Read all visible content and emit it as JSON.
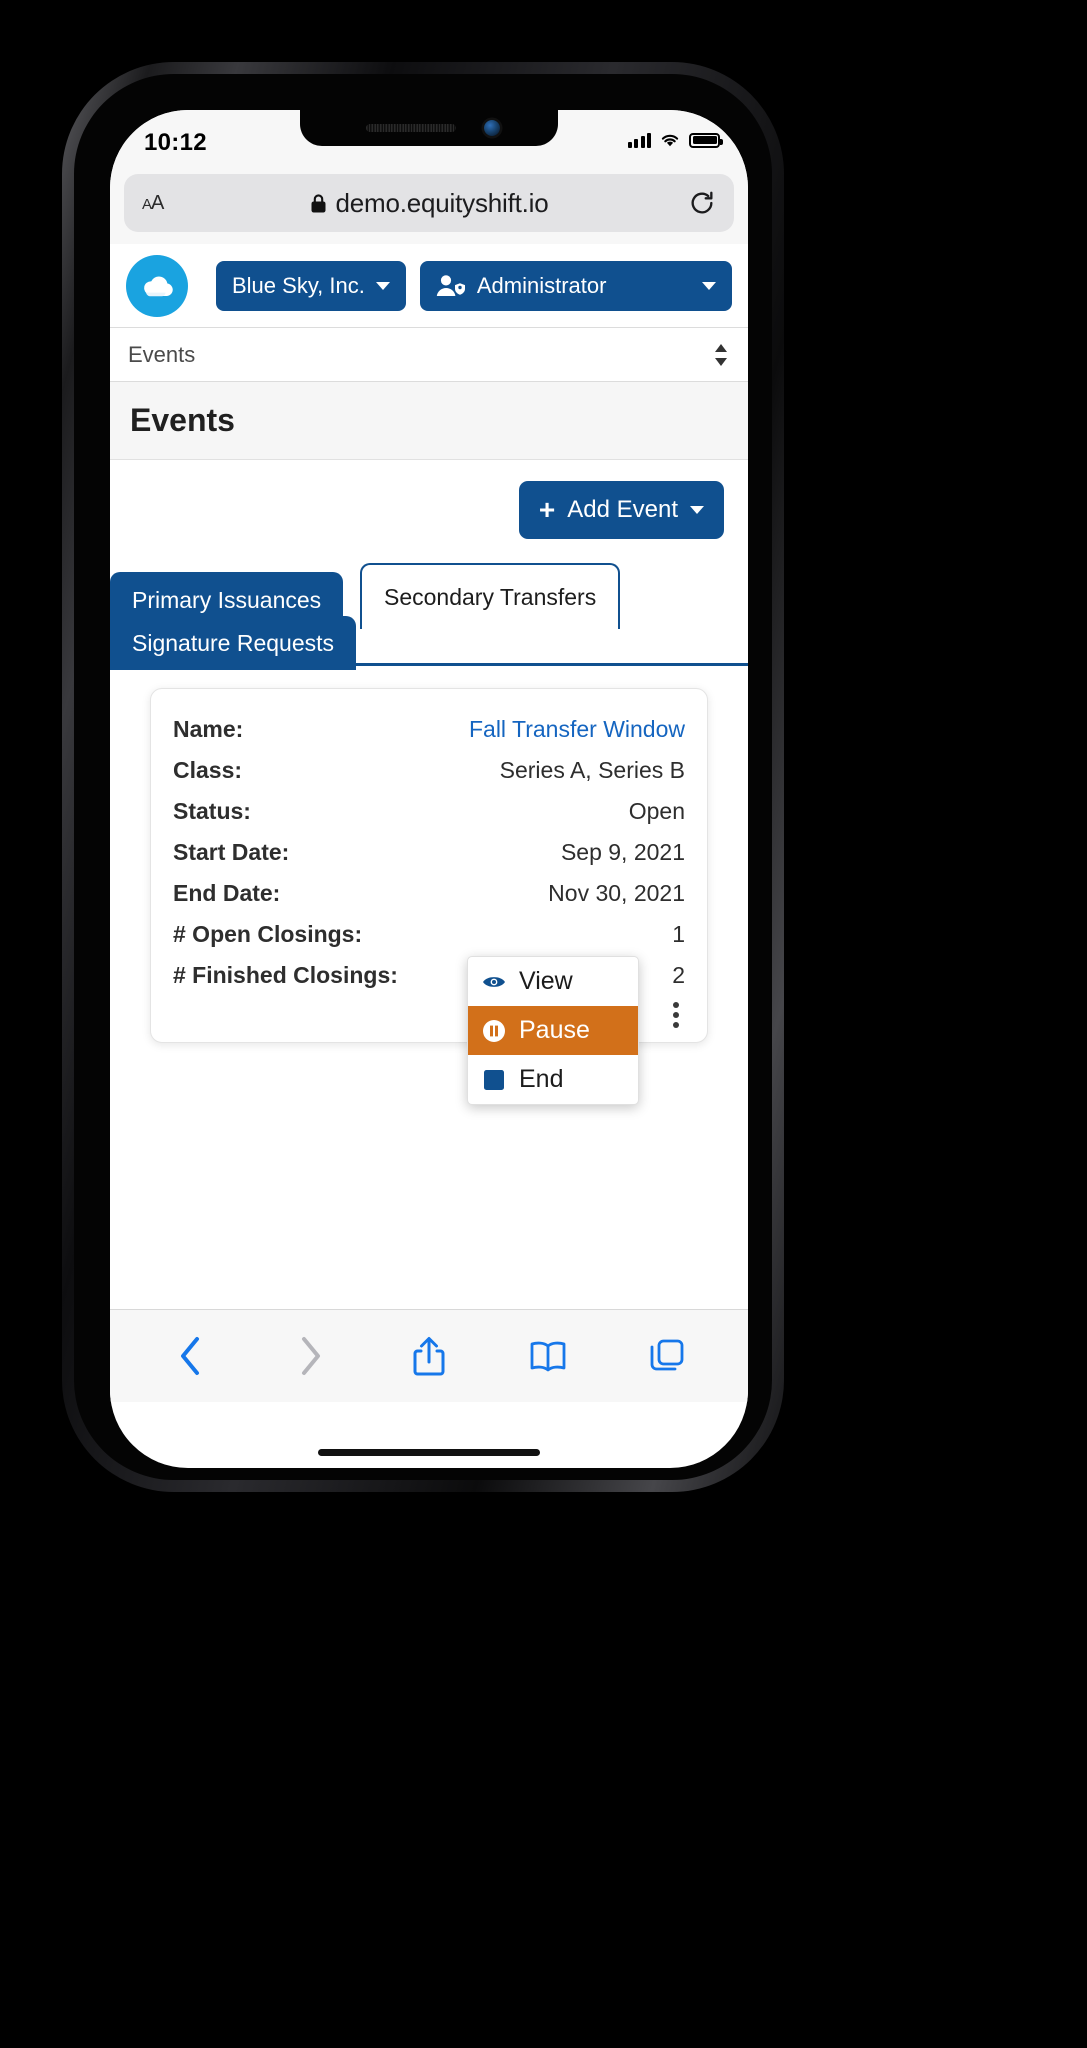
{
  "status_bar": {
    "time": "10:12",
    "signal_icon": "cellular-signal-icon",
    "wifi_icon": "wifi-icon",
    "battery_icon": "battery-icon"
  },
  "browser": {
    "aa_label_small": "A",
    "aa_label_large": "A",
    "lock_icon": "lock-icon",
    "url": "demo.equityshift.io",
    "reload_icon": "reload-icon",
    "toolbar": {
      "back": "back-icon",
      "forward": "forward-icon",
      "share": "share-icon",
      "bookmarks": "book-icon",
      "tabs": "tabs-icon"
    }
  },
  "app_header": {
    "logo_icon": "cloud-logo-icon",
    "company_button": "Blue Sky, Inc.",
    "role_button": "Administrator",
    "role_icon": "user-shield-icon",
    "caret_icon": "chevron-down-icon"
  },
  "breadcrumb": {
    "label": "Events",
    "sort_icon": "sort-updown-icon"
  },
  "page": {
    "title": "Events",
    "add_event_label": "Add Event",
    "add_event_plus": "+",
    "add_event_caret": "chevron-down-icon"
  },
  "tabs": [
    {
      "label": "Primary Issuances",
      "active": false
    },
    {
      "label": "Signature Requests",
      "active": false
    },
    {
      "label": "Secondary Transfers",
      "active": true
    }
  ],
  "event_card": {
    "rows": [
      {
        "label": "Name:",
        "value": "Fall Transfer Window",
        "is_link": true
      },
      {
        "label": "Class:",
        "value": "Series A, Series B",
        "is_link": false
      },
      {
        "label": "Status:",
        "value": "Open",
        "is_link": false
      },
      {
        "label": "Start Date:",
        "value": "Sep 9, 2021",
        "is_link": false
      },
      {
        "label": "End Date:",
        "value": "Nov 30, 2021",
        "is_link": false
      },
      {
        "label": "# Open Closings:",
        "value": "1",
        "is_link": false
      },
      {
        "label": "# Finished Closings:",
        "value": "2",
        "is_link": false
      }
    ],
    "kebab_icon": "kebab-menu-icon"
  },
  "context_menu": {
    "items": [
      {
        "label": "View",
        "icon": "eye-icon",
        "highlighted": false
      },
      {
        "label": "Pause",
        "icon": "pause-circle-icon",
        "highlighted": true
      },
      {
        "label": "End",
        "icon": "stop-square-icon",
        "highlighted": false
      }
    ]
  },
  "colors": {
    "brand_blue": "#10508f",
    "logo_cyan": "#1aa3e0",
    "link_blue": "#1565c0",
    "highlight_orange": "#d2701a",
    "safari_blue": "#1677ea"
  }
}
